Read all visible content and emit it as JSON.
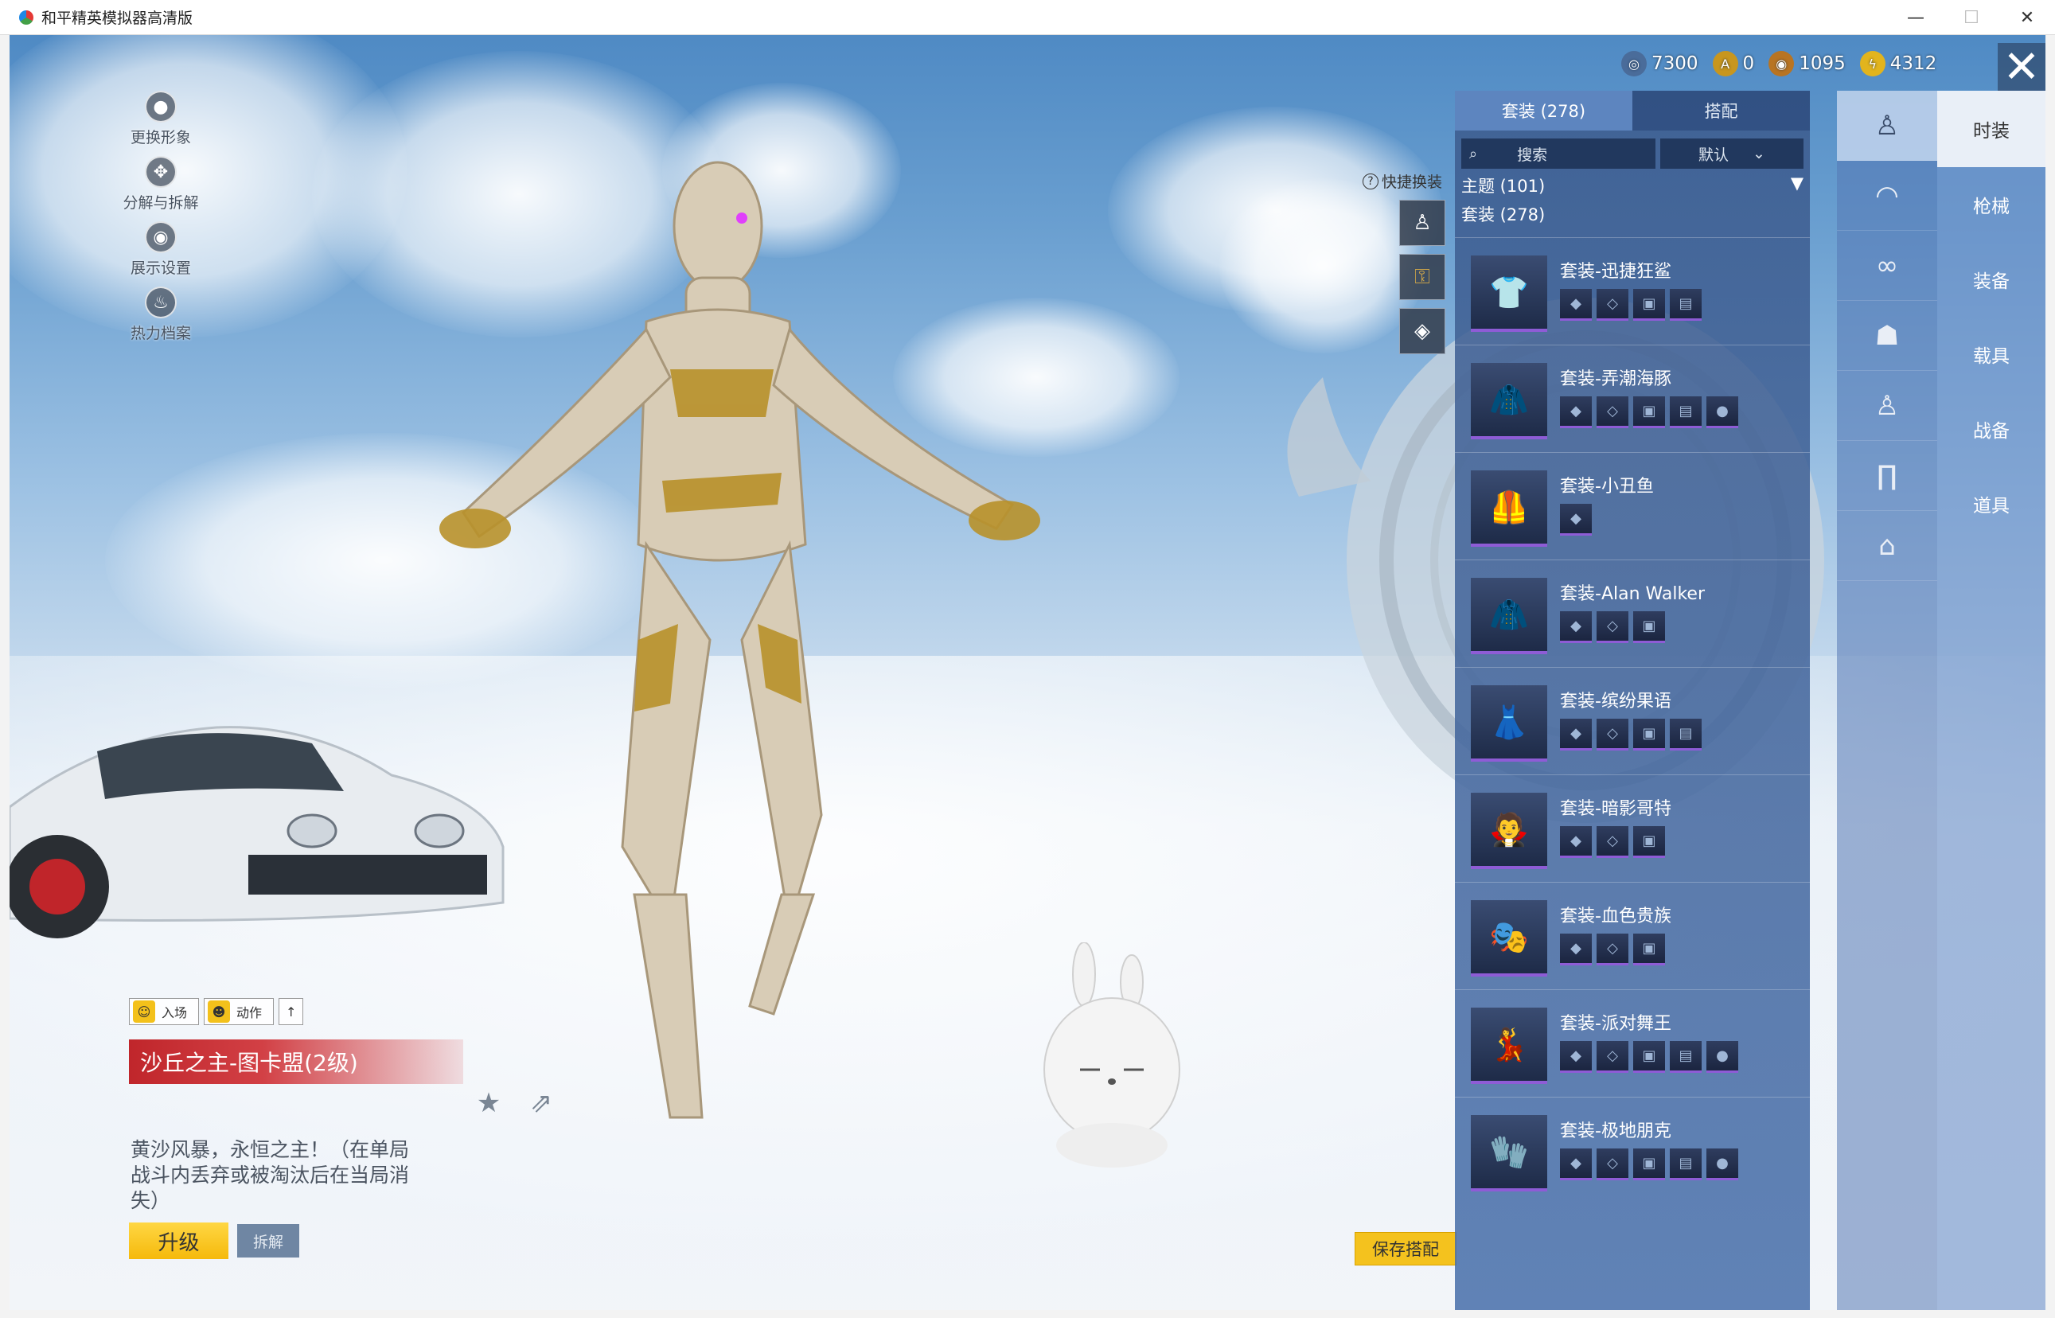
{
  "window": {
    "title": "和平精英模拟器高清版",
    "min": "—",
    "max": "☐",
    "close": "✕"
  },
  "left_menu": [
    {
      "label": "更换形象",
      "icon": "person-icon"
    },
    {
      "label": "分解与拆解",
      "icon": "gear-icon"
    },
    {
      "label": "展示设置",
      "icon": "eye-icon"
    },
    {
      "label": "热力档案",
      "icon": "flame-icon"
    }
  ],
  "currency": [
    {
      "value": "7300",
      "color": "#4a6c9a"
    },
    {
      "value": "0",
      "color": "#c8961e"
    },
    {
      "value": "1095",
      "color": "#b87422"
    },
    {
      "value": "4312",
      "color": "#e2b41d"
    }
  ],
  "quick_swap": {
    "label": "快捷换装"
  },
  "actions": {
    "enter": "入场",
    "motion": "动作",
    "up": "↑"
  },
  "item": {
    "title": "沙丘之主-图卡盟(2级)",
    "desc": "黄沙风暴，永恒之主！（在单局战斗内丢弃或被淘汰后在当局消失）",
    "upgrade": "升级",
    "dismantle": "拆解",
    "save": "保存搭配"
  },
  "panel": {
    "tabs": [
      "套装 (278)",
      "搭配"
    ],
    "search_placeholder": "搜索",
    "sort": "默认",
    "theme": "主题 (101)",
    "subtheme": "套装 (278)",
    "suits": [
      {
        "name": "套装-迅捷狂鲨",
        "items": 4
      },
      {
        "name": "套装-弄潮海豚",
        "items": 5
      },
      {
        "name": "套装-小丑鱼",
        "items": 1
      },
      {
        "name": "套装-Alan Walker",
        "items": 3
      },
      {
        "name": "套装-缤纷果语",
        "items": 4
      },
      {
        "name": "套装-暗影哥特",
        "items": 3
      },
      {
        "name": "套装-血色贵族",
        "items": 3
      },
      {
        "name": "套装-派对舞王",
        "items": 5
      },
      {
        "name": "套装-极地朋克",
        "items": 5
      }
    ]
  },
  "categories": [
    "figure-icon",
    "cap-icon",
    "glasses-icon",
    "mask-icon",
    "body-icon",
    "pants-icon",
    "shoes-icon"
  ],
  "side_tabs": [
    "时装",
    "枪械",
    "装备",
    "载具",
    "战备",
    "道具"
  ]
}
